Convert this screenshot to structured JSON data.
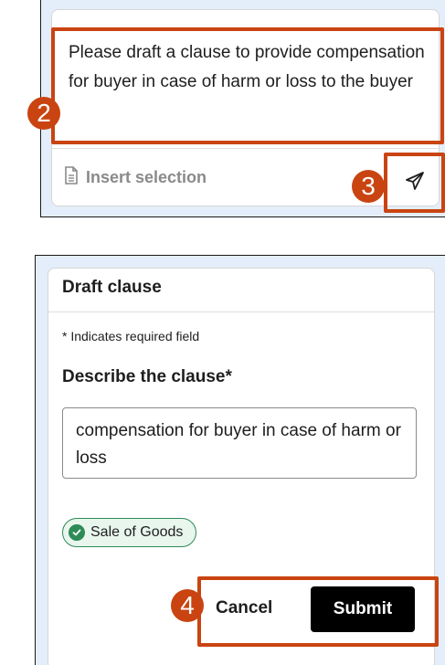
{
  "composer": {
    "prompt_text": "Please draft a clause to provide compensation for buyer in case of harm or loss to the buyer",
    "insert_selection_label": "Insert selection",
    "icons": {
      "insert": "document-icon",
      "send": "send-icon"
    }
  },
  "steps": {
    "two": "2",
    "three": "3",
    "four": "4"
  },
  "form": {
    "title": "Draft clause",
    "required_note": "* Indicates required field",
    "field_label": "Describe the clause*",
    "field_value": "compensation for buyer in case of harm or loss",
    "tag_label": "Sale of Goods",
    "cancel_label": "Cancel",
    "submit_label": "Submit"
  },
  "colors": {
    "highlight": "#c94411",
    "panel_bg": "#e4eefa",
    "tag_green": "#2e8b57",
    "submit_bg": "#000000"
  }
}
